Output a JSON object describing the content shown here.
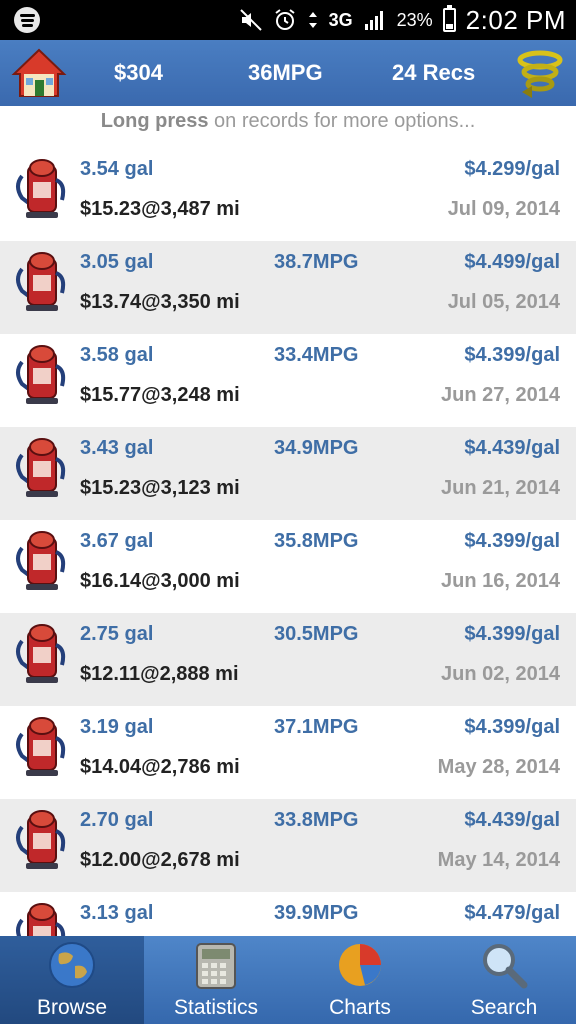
{
  "status_bar": {
    "network": "3G",
    "battery": "23%",
    "time": "2:02 PM"
  },
  "action_bar": {
    "total_cost": "$304",
    "avg_mpg": "36MPG",
    "record_count": "24 Recs"
  },
  "hint": {
    "bold": "Long press",
    "rest": " on records for more options..."
  },
  "records": [
    {
      "gallons": "3.54 gal",
      "mpg": "",
      "price": "$4.299/gal",
      "cost_odo": "$15.23@3,487 mi",
      "date": "Jul 09, 2014"
    },
    {
      "gallons": "3.05 gal",
      "mpg": "38.7MPG",
      "price": "$4.499/gal",
      "cost_odo": "$13.74@3,350 mi",
      "date": "Jul 05, 2014"
    },
    {
      "gallons": "3.58 gal",
      "mpg": "33.4MPG",
      "price": "$4.399/gal",
      "cost_odo": "$15.77@3,248 mi",
      "date": "Jun 27, 2014"
    },
    {
      "gallons": "3.43 gal",
      "mpg": "34.9MPG",
      "price": "$4.439/gal",
      "cost_odo": "$15.23@3,123 mi",
      "date": "Jun 21, 2014"
    },
    {
      "gallons": "3.67 gal",
      "mpg": "35.8MPG",
      "price": "$4.399/gal",
      "cost_odo": "$16.14@3,000 mi",
      "date": "Jun 16, 2014"
    },
    {
      "gallons": "2.75 gal",
      "mpg": "30.5MPG",
      "price": "$4.399/gal",
      "cost_odo": "$12.11@2,888 mi",
      "date": "Jun 02, 2014"
    },
    {
      "gallons": "3.19 gal",
      "mpg": "37.1MPG",
      "price": "$4.399/gal",
      "cost_odo": "$14.04@2,786 mi",
      "date": "May 28, 2014"
    },
    {
      "gallons": "2.70 gal",
      "mpg": "33.8MPG",
      "price": "$4.439/gal",
      "cost_odo": "$12.00@2,678 mi",
      "date": "May 14, 2014"
    },
    {
      "gallons": "3.13 gal",
      "mpg": "39.9MPG",
      "price": "$4.479/gal",
      "cost_odo": "",
      "date": ""
    }
  ],
  "tabs": [
    {
      "label": "Browse",
      "icon": "globe-icon",
      "active": true
    },
    {
      "label": "Statistics",
      "icon": "calculator-icon",
      "active": false
    },
    {
      "label": "Charts",
      "icon": "pie-chart-icon",
      "active": false
    },
    {
      "label": "Search",
      "icon": "magnifier-icon",
      "active": false
    }
  ],
  "colors": {
    "action_bar": "#3f73b8",
    "record_text": "#3f6ea6",
    "alt_row": "#ececec"
  }
}
